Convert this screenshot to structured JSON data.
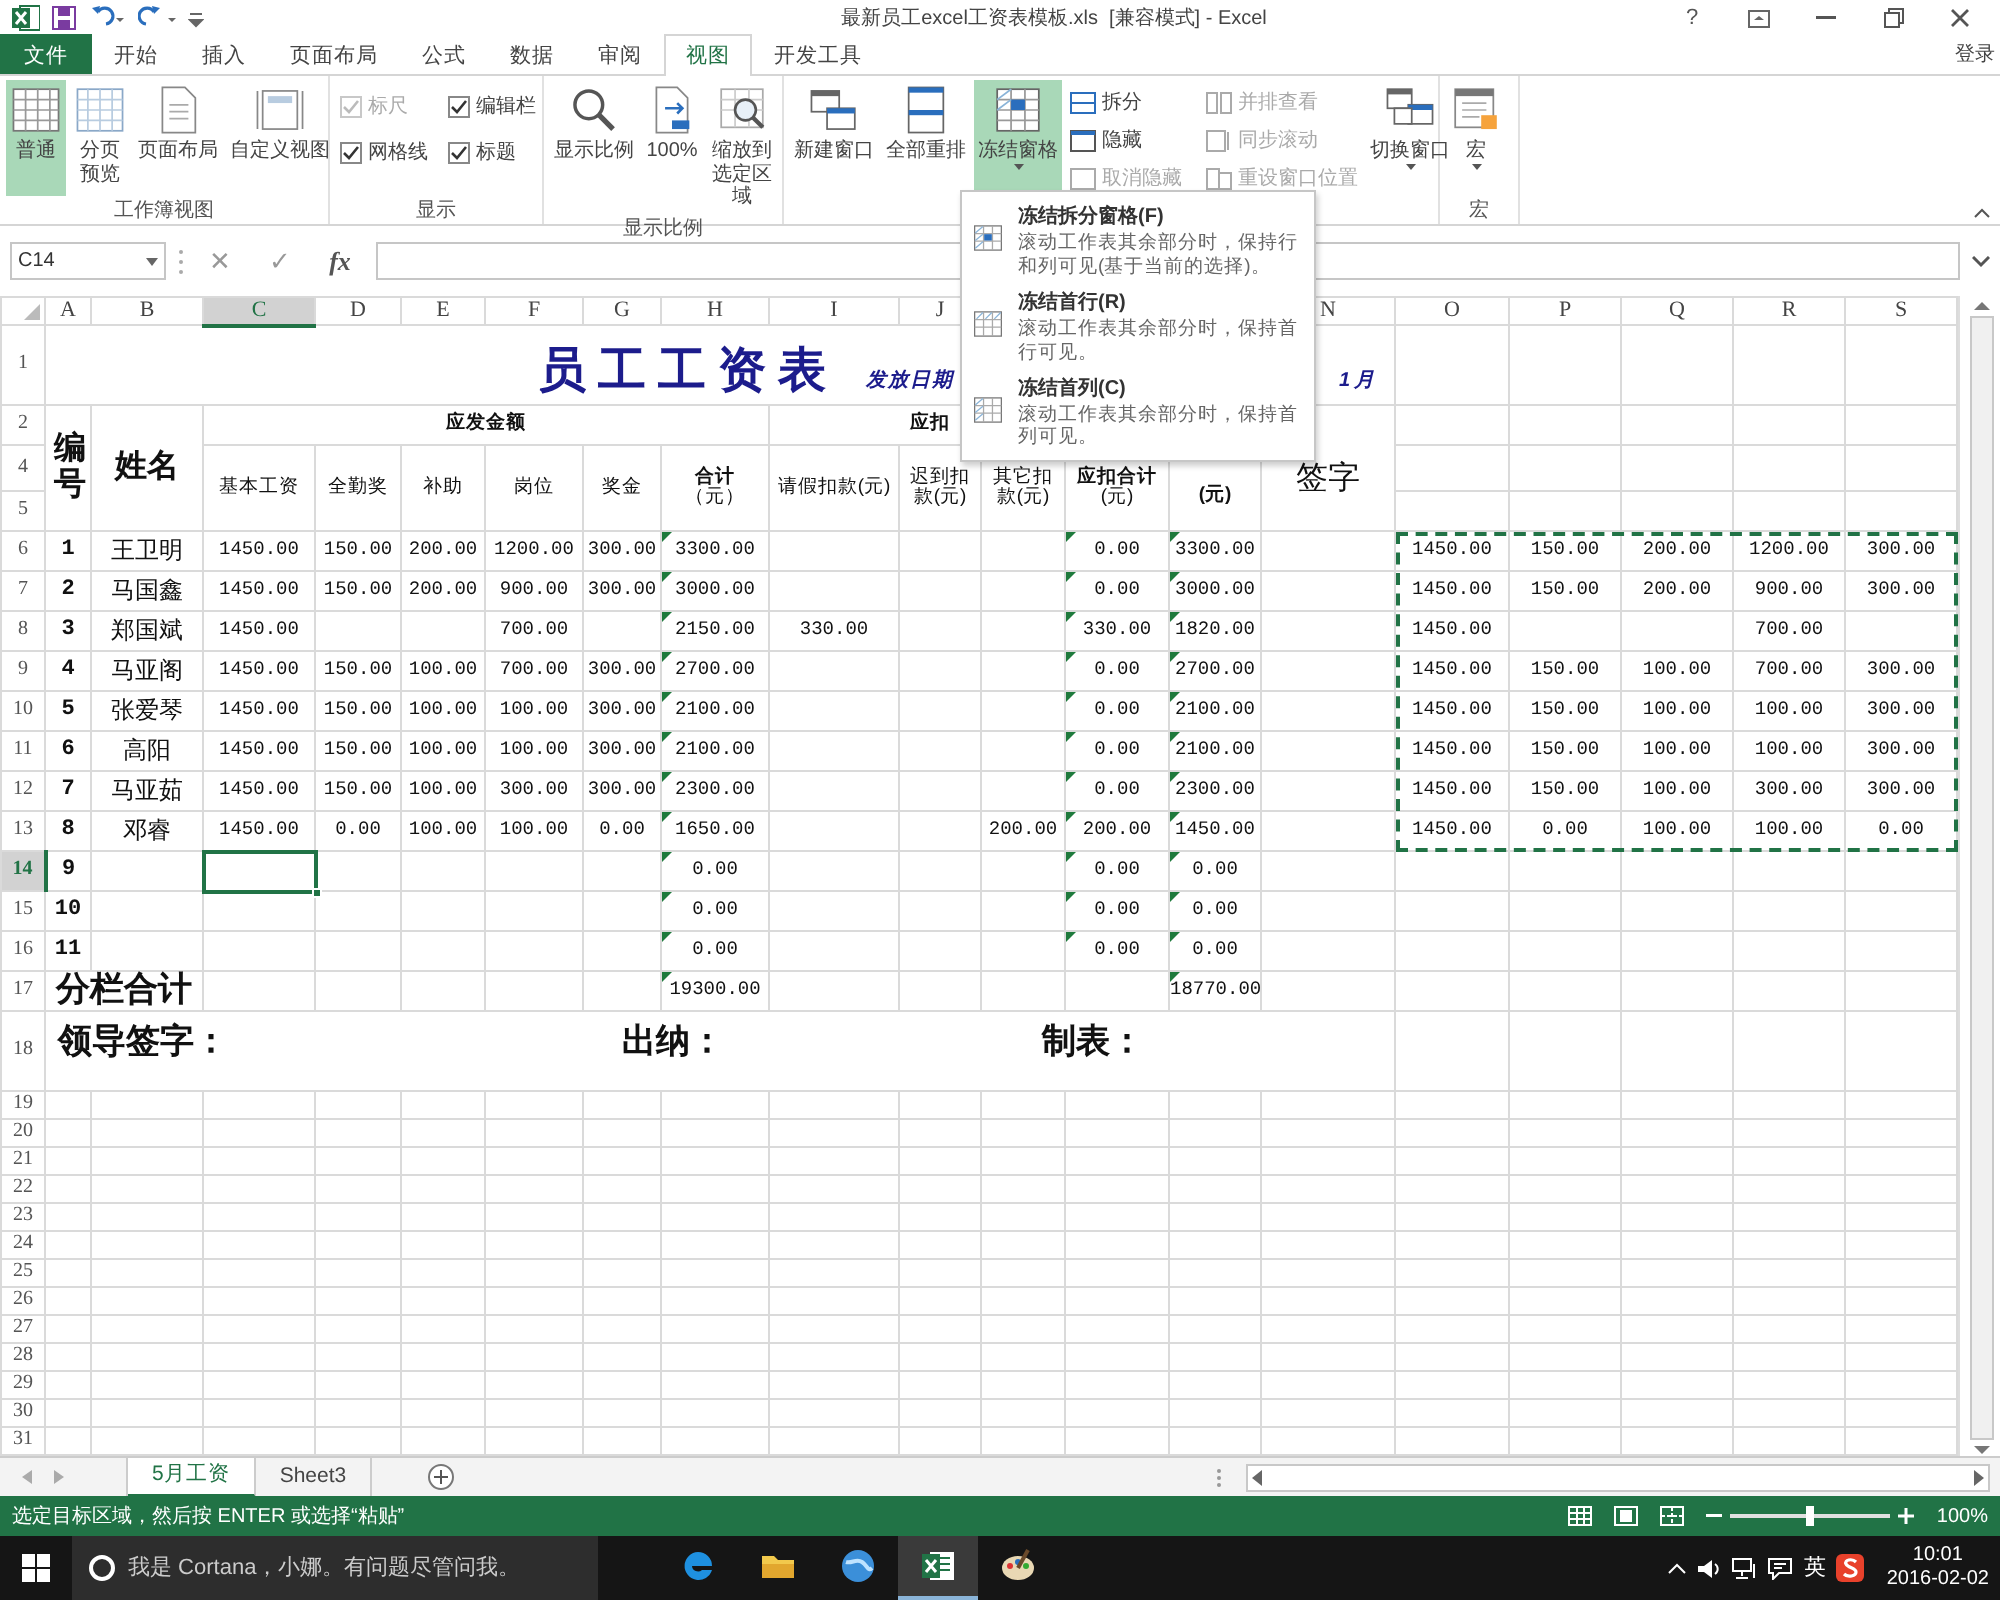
{
  "window": {
    "title": "最新员工excel工资表模板.xls  [兼容模式] - Excel",
    "help": "?",
    "sign_in": "登录"
  },
  "ribbon_tabs": [
    {
      "label": "文件",
      "kind": "file",
      "selected": false
    },
    {
      "label": "开始",
      "kind": "tab",
      "selected": false
    },
    {
      "label": "插入",
      "kind": "tab",
      "selected": false
    },
    {
      "label": "页面布局",
      "kind": "tab",
      "selected": false
    },
    {
      "label": "公式",
      "kind": "tab",
      "selected": false
    },
    {
      "label": "数据",
      "kind": "tab",
      "selected": false
    },
    {
      "label": "审阅",
      "kind": "tab",
      "selected": false
    },
    {
      "label": "视图",
      "kind": "tab",
      "selected": true
    },
    {
      "label": "开发工具",
      "kind": "tab",
      "selected": false
    }
  ],
  "ribbon_groups": [
    {
      "label": "工作簿视图",
      "items": [
        {
          "kind": "large",
          "label": "普通",
          "selected": true
        },
        {
          "kind": "large",
          "label": "分页预览",
          "selected": false
        },
        {
          "kind": "large",
          "label": "页面布局",
          "selected": false
        },
        {
          "kind": "large",
          "label": "自定义视图",
          "selected": false
        }
      ]
    },
    {
      "label": "显示",
      "items": [
        {
          "kind": "check",
          "label": "标尺",
          "checked": true,
          "disabled": true
        },
        {
          "kind": "check",
          "label": "编辑栏",
          "checked": true,
          "disabled": false
        },
        {
          "kind": "check",
          "label": "网格线",
          "checked": true,
          "disabled": false
        },
        {
          "kind": "check",
          "label": "标题",
          "checked": true,
          "disabled": false
        }
      ]
    },
    {
      "label": "显示比例",
      "items": [
        {
          "kind": "large",
          "label": "显示比例",
          "selected": false
        },
        {
          "kind": "large",
          "label": "100%",
          "selected": false
        },
        {
          "kind": "large",
          "label": "缩放到选定区域",
          "selected": false
        }
      ]
    },
    {
      "items": [
        {
          "kind": "large",
          "label": "新建窗口",
          "selected": false
        },
        {
          "kind": "large",
          "label": "全部重排",
          "selected": false
        },
        {
          "kind": "large",
          "label": "冻结窗格",
          "selected": true,
          "has_menu": true
        },
        {
          "kind": "small",
          "label": "拆分",
          "disabled": false
        },
        {
          "kind": "small",
          "label": "隐藏",
          "disabled": false
        },
        {
          "kind": "small",
          "label": "取消隐藏",
          "disabled": true
        },
        {
          "kind": "small",
          "label": "并排查看",
          "disabled": true
        },
        {
          "kind": "small",
          "label": "同步滚动",
          "disabled": true
        },
        {
          "kind": "small",
          "label": "重设窗口位置",
          "disabled": true
        },
        {
          "kind": "large",
          "label": "切换窗口",
          "selected": false,
          "has_menu": true
        }
      ]
    },
    {
      "label": "宏",
      "items": [
        {
          "kind": "large",
          "label": "宏",
          "selected": false,
          "has_menu": true
        }
      ]
    }
  ],
  "freeze_menu": [
    {
      "title": "冻结拆分窗格(F)",
      "description": "滚动工作表其余部分时，保持行和列可见(基于当前的选择)。"
    },
    {
      "title": "冻结首行(R)",
      "description": "滚动工作表其余部分时，保持首行可见。"
    },
    {
      "title": "冻结首列(C)",
      "description": "滚动工作表其余部分时，保持首列可见。"
    }
  ],
  "formula_bar": {
    "name_box": "C14",
    "buttons": [
      "✕",
      "✓",
      "fx"
    ]
  },
  "sheet": {
    "column_headers_left": [
      {
        "label": "A",
        "selected": false
      },
      {
        "label": "B",
        "selected": false
      },
      {
        "label": "C",
        "selected": true
      },
      {
        "label": "D",
        "selected": false
      },
      {
        "label": "E",
        "selected": false
      },
      {
        "label": "F",
        "selected": false
      },
      {
        "label": "G",
        "selected": false
      },
      {
        "label": "H",
        "selected": false
      },
      {
        "label": "I",
        "selected": false
      },
      {
        "label": "J",
        "selected": false
      }
    ],
    "column_headers_right": [
      {
        "label": "N",
        "selected": false
      },
      {
        "label": "O",
        "selected": false
      },
      {
        "label": "P",
        "selected": false
      },
      {
        "label": "Q",
        "selected": false
      },
      {
        "label": "R",
        "selected": false
      },
      {
        "label": "S",
        "selected": false
      }
    ],
    "row_numbers": [
      {
        "label": "1",
        "selected": false
      },
      {
        "label": "2",
        "selected": false
      },
      {
        "label": "4",
        "selected": false
      },
      {
        "label": "5",
        "selected": false
      },
      {
        "label": "6",
        "selected": false
      },
      {
        "label": "7",
        "selected": false
      },
      {
        "label": "8",
        "selected": false
      },
      {
        "label": "9",
        "selected": false
      },
      {
        "label": "10",
        "selected": false
      },
      {
        "label": "11",
        "selected": false
      },
      {
        "label": "12",
        "selected": false
      },
      {
        "label": "13",
        "selected": false
      },
      {
        "label": "14",
        "selected": true
      },
      {
        "label": "15",
        "selected": false
      },
      {
        "label": "16",
        "selected": false
      },
      {
        "label": "17",
        "selected": false
      },
      {
        "label": "18",
        "selected": false
      },
      {
        "label": "19",
        "selected": false
      },
      {
        "label": "20",
        "selected": false
      },
      {
        "label": "21",
        "selected": false
      },
      {
        "label": "22",
        "selected": false
      },
      {
        "label": "23",
        "selected": false
      },
      {
        "label": "24",
        "selected": false
      },
      {
        "label": "25",
        "selected": false
      },
      {
        "label": "26",
        "selected": false
      },
      {
        "label": "27",
        "selected": false
      },
      {
        "label": "28",
        "selected": false
      },
      {
        "label": "29",
        "selected": false
      },
      {
        "label": "30",
        "selected": false
      },
      {
        "label": "31",
        "selected": false
      }
    ],
    "title": "员工工资表",
    "date_label": "发放日期",
    "date_tail": "1月",
    "header": {
      "id": "编号",
      "name": "姓名",
      "gross_group": "应发金额",
      "deduct_group": "应扣",
      "gross_columns": [
        "基本工资",
        "全勤奖",
        "补助",
        "岗位",
        "奖金",
        "**合计**（元）"
      ],
      "deduct_columns": [
        "请假扣款(元)",
        "迟到扣款(元)",
        "其它扣款(元)",
        "**应扣合计**(元)"
      ],
      "net": "(元)",
      "sign": "签字"
    },
    "rows": [
      {
        "kind": "data",
        "no": "1",
        "name": "王卫明",
        "values": {
          "C": "1450.00",
          "D": "150.00",
          "E": "200.00",
          "F": "1200.00",
          "G": "300.00",
          "H": "3300.00",
          "L": "0.00",
          "M": "3300.00"
        },
        "copy": {
          "O": "1450.00",
          "P": "150.00",
          "Q": "200.00",
          "R": "1200.00",
          "S": "300.00"
        }
      },
      {
        "kind": "data",
        "no": "2",
        "name": "马国鑫",
        "values": {
          "C": "1450.00",
          "D": "150.00",
          "E": "200.00",
          "F": "900.00",
          "G": "300.00",
          "H": "3000.00",
          "L": "0.00",
          "M": "3000.00"
        },
        "copy": {
          "O": "1450.00",
          "P": "150.00",
          "Q": "200.00",
          "R": "900.00",
          "S": "300.00"
        }
      },
      {
        "kind": "data",
        "no": "3",
        "name": "郑国斌",
        "values": {
          "C": "1450.00",
          "F": "700.00",
          "H": "2150.00",
          "I": "330.00",
          "L": "330.00",
          "M": "1820.00"
        },
        "copy": {
          "O": "1450.00",
          "R": "700.00"
        }
      },
      {
        "kind": "data",
        "no": "4",
        "name": "马亚阁",
        "values": {
          "C": "1450.00",
          "D": "150.00",
          "E": "100.00",
          "F": "700.00",
          "G": "300.00",
          "H": "2700.00",
          "L": "0.00",
          "M": "2700.00"
        },
        "copy": {
          "O": "1450.00",
          "P": "150.00",
          "Q": "100.00",
          "R": "700.00",
          "S": "300.00"
        }
      },
      {
        "kind": "data",
        "no": "5",
        "name": "张爱琴",
        "values": {
          "C": "1450.00",
          "D": "150.00",
          "E": "100.00",
          "F": "100.00",
          "G": "300.00",
          "H": "2100.00",
          "L": "0.00",
          "M": "2100.00"
        },
        "copy": {
          "O": "1450.00",
          "P": "150.00",
          "Q": "100.00",
          "R": "100.00",
          "S": "300.00"
        }
      },
      {
        "kind": "data",
        "no": "6",
        "name": "高阳",
        "values": {
          "C": "1450.00",
          "D": "150.00",
          "E": "100.00",
          "F": "100.00",
          "G": "300.00",
          "H": "2100.00",
          "L": "0.00",
          "M": "2100.00"
        },
        "copy": {
          "O": "1450.00",
          "P": "150.00",
          "Q": "100.00",
          "R": "100.00",
          "S": "300.00"
        }
      },
      {
        "kind": "data",
        "no": "7",
        "name": "马亚茹",
        "values": {
          "C": "1450.00",
          "D": "150.00",
          "E": "100.00",
          "F": "300.00",
          "G": "300.00",
          "H": "2300.00",
          "L": "0.00",
          "M": "2300.00"
        },
        "copy": {
          "O": "1450.00",
          "P": "150.00",
          "Q": "100.00",
          "R": "300.00",
          "S": "300.00"
        }
      },
      {
        "kind": "data",
        "no": "8",
        "name": "邓睿",
        "values": {
          "C": "1450.00",
          "D": "0.00",
          "E": "100.00",
          "F": "100.00",
          "G": "0.00",
          "H": "1650.00",
          "K": "200.00",
          "L": "200.00",
          "M": "1450.00"
        },
        "copy": {
          "O": "1450.00",
          "P": "0.00",
          "Q": "100.00",
          "R": "100.00",
          "S": "0.00"
        }
      },
      {
        "kind": "data",
        "no": "9",
        "values": {
          "H": "0.00",
          "L": "0.00",
          "M": "0.00"
        }
      },
      {
        "kind": "data",
        "no": "10",
        "values": {
          "H": "0.00",
          "L": "0.00",
          "M": "0.00"
        }
      },
      {
        "kind": "data",
        "no": "11",
        "values": {
          "H": "0.00",
          "L": "0.00",
          "M": "0.00"
        }
      },
      {
        "kind": "total",
        "label": "分栏合计",
        "values": {
          "H": "19300.00",
          "M": "18770.00"
        }
      }
    ],
    "signatures": [
      "领导签字：",
      "出纳：",
      "制表："
    ]
  },
  "sheet_tabs": [
    {
      "label": "5月工资",
      "selected": true
    },
    {
      "label": "Sheet3",
      "selected": false
    }
  ],
  "status_bar": {
    "message": "选定目标区域，然后按 ENTER 或选择“粘贴”",
    "zoom": "100%",
    "zoom_slider": {
      "level": 0.5
    }
  },
  "taskbar": {
    "search_placeholder": "我是 Cortana，小娜。有问题尽管问我。",
    "apps": [
      {
        "selected": false
      },
      {
        "selected": false
      },
      {
        "selected": false
      },
      {
        "selected": true
      },
      {
        "selected": false
      }
    ],
    "ime": "英",
    "time": "10:01",
    "date": "2016-02-02"
  }
}
